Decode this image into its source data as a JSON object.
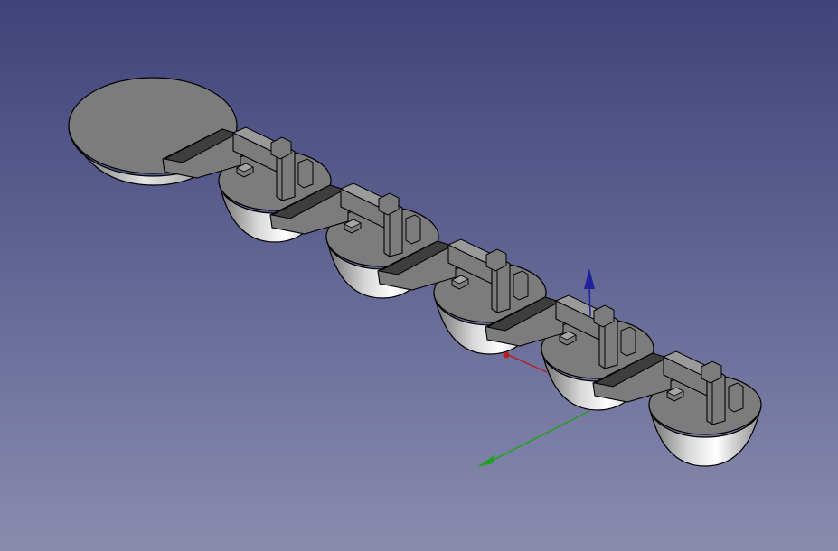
{
  "viewport": {
    "background_top": "#3f4379",
    "background_bottom": "#8a8cae"
  },
  "model": {
    "part_count": 6,
    "body_color": "#7c7c7c",
    "edge_color": "#000000"
  },
  "axes": {
    "x_color": "#b02020",
    "y_color": "#22a022",
    "z_color": "#20209a"
  }
}
